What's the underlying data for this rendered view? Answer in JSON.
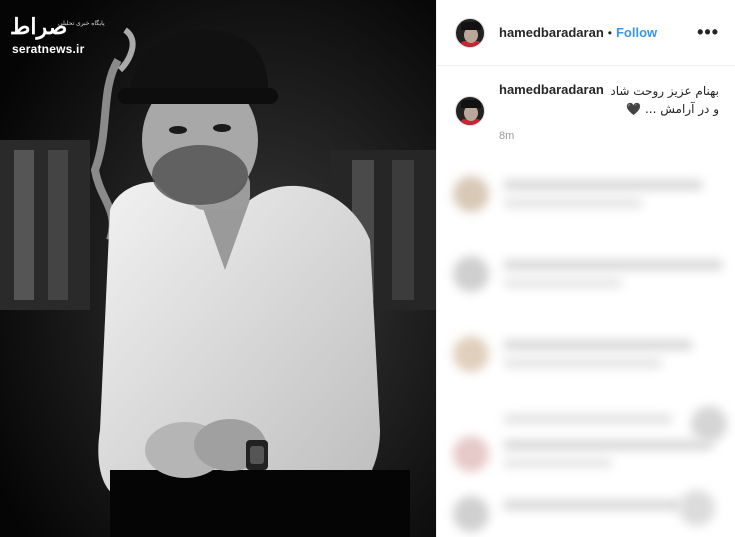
{
  "watermark": {
    "logo_text": "صراط",
    "tagline": "پایگاه خبری تحلیلی",
    "url": "seratnews.ir"
  },
  "post": {
    "username": "hamedbaradaran",
    "separator": "•",
    "follow_label": "Follow",
    "more_icon": "more-options-icon",
    "caption_user": "hamedbaradaran",
    "caption_line1": "بهنام عزیز روحت شاد",
    "caption_line2": "و در آرامش ... 🖤",
    "time": "8m"
  },
  "colors": {
    "follow": "#3897f0",
    "photo_bg": "#0b0b0b"
  }
}
